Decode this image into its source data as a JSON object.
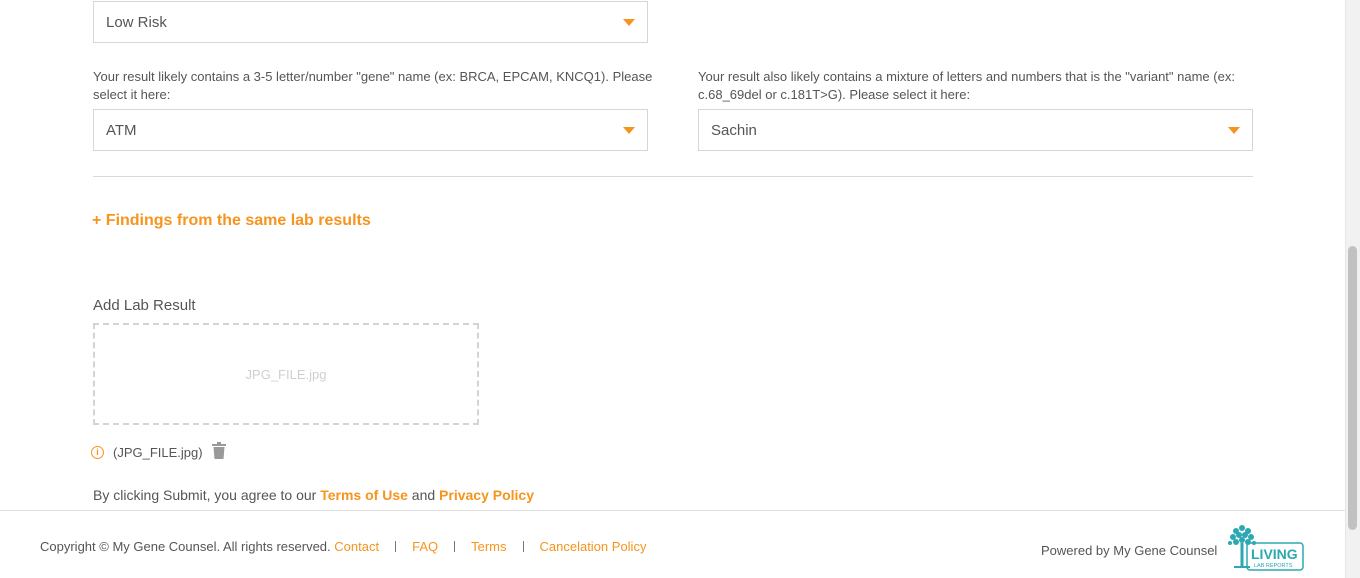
{
  "risk_select": {
    "value": "Low Risk"
  },
  "gene": {
    "label": "Your result likely contains a 3-5 letter/number \"gene\" name (ex: BRCA, EPCAM, KNCQ1). Please select it here:",
    "value": "ATM"
  },
  "variant": {
    "label": "Your result also likely contains a mixture of letters and numbers that is the \"variant\" name (ex: c.68_69del or c.181T>G). Please select it here:",
    "value": "Sachin"
  },
  "findings_link": "+ Findings from the same lab results",
  "lab_result": {
    "title": "Add Lab Result",
    "dropzone_text": "JPG_FILE.jpg",
    "file_name": "(JPG_FILE.jpg)"
  },
  "agreement": {
    "prefix": "By clicking Submit, you agree to our",
    "terms": "Terms of Use",
    "and": "and",
    "privacy": "Privacy Policy"
  },
  "footer": {
    "copyright": "Copyright © My Gene Counsel. All rights reserved.",
    "links": [
      "Contact",
      "FAQ",
      "Terms",
      "Cancelation Policy"
    ],
    "powered_by": "Powered by My Gene Counsel",
    "logo_text": [
      "LIVING",
      "LAB REPORTS"
    ]
  },
  "colors": {
    "accent": "#f7941d",
    "text": "#555555",
    "logo": "#2aa9b3"
  },
  "icons": {
    "caret": "chevron-down-icon",
    "info": "info-icon",
    "trash": "trash-icon"
  }
}
